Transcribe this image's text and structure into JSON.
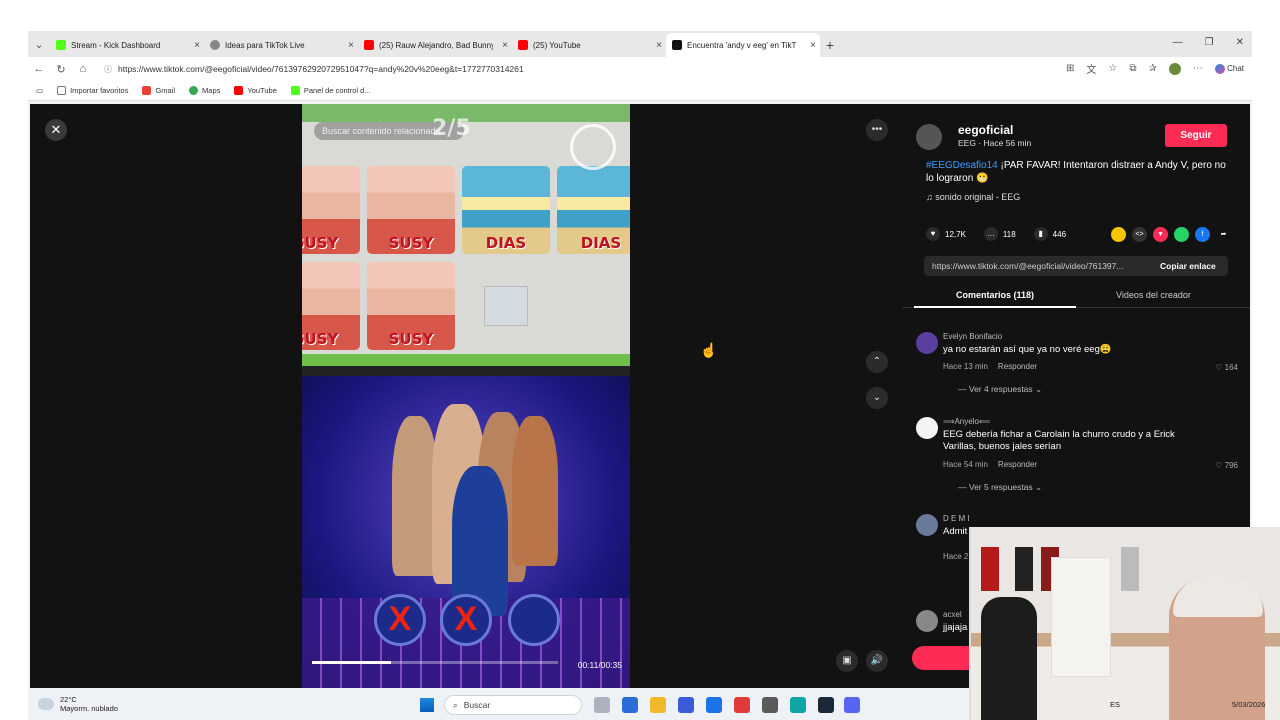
{
  "browser": {
    "tabs": [
      {
        "label": "Stream - Kick Dashboard",
        "color": "#53fc18"
      },
      {
        "label": "Ideas para TikTok Live",
        "color": "#888888"
      },
      {
        "label": "(25) Rauw Alejandro, Bad Bunny -",
        "color": "#ff0000"
      },
      {
        "label": "(25) YouTube",
        "color": "#ff0000"
      },
      {
        "label": "Encuentra 'andy v eeg' en TikT",
        "color": "#111111"
      }
    ],
    "url": "https://www.tiktok.com/@eegoficial/video/7613976292072951047?q=andy%20v%20eeg&t=1772770314261",
    "chat_label": "Chat",
    "bookmarks": [
      "Importar favoritos",
      "Gmail",
      "Maps",
      "YouTube",
      "Panel de control d..."
    ]
  },
  "video": {
    "search_placeholder": "Buscar contenido relacionado",
    "counter": "2/5",
    "cards": [
      "SUSY",
      "SUSY",
      "DIAS",
      "DIAS",
      "SUSY",
      "SUSY"
    ],
    "x_marks": [
      "X",
      "X"
    ],
    "timecode": "00:11/00:35",
    "progress": 0.32
  },
  "post": {
    "username": "eegoficial",
    "subline": "EEG · Hace 56 min",
    "follow_label": "Seguir",
    "hashtag": "#EEGDesafio14",
    "description": " ¡PAR FAVAR! Intentaron distraer a Andy V, pero no lo lograron 😬",
    "sound": "sonido original - EEG",
    "likes": "12,7K",
    "comments": "118",
    "saves": "446",
    "link": "https://www.tiktok.com/@eegoficial/video/761397...",
    "copy_label": "Copiar enlace",
    "tab_comments": "Comentarios (118)",
    "tab_creator": "Videos del creador"
  },
  "comments": [
    {
      "author": "Evelyn Bonifacio",
      "text": "ya no estarán así que ya no veré eeg😩",
      "time": "Hace 13 min",
      "reply": "Responder",
      "likes": "164",
      "more": "Ver 4 respuestas"
    },
    {
      "author": "⟹Anyelo⟸",
      "text": "EEG debería fichar a Carolain la churro crudo y a Erick Varillas, buenos jales serían",
      "time": "Hace 54 min",
      "reply": "Responder",
      "likes": "796",
      "more": "Ver 5 respuestas"
    },
    {
      "author": "D E M I",
      "text": "Admit",
      "time": "Hace 2",
      "reply": "",
      "likes": "",
      "more": ""
    },
    {
      "author": "acxel",
      "text": "jjajaja",
      "time": "",
      "reply": "",
      "likes": "",
      "more": ""
    }
  ],
  "taskbar": {
    "temp": "22°C",
    "weather": "Mayorm. nublado",
    "search": "Buscar",
    "lang": "ES",
    "date": "5/03/2026"
  }
}
